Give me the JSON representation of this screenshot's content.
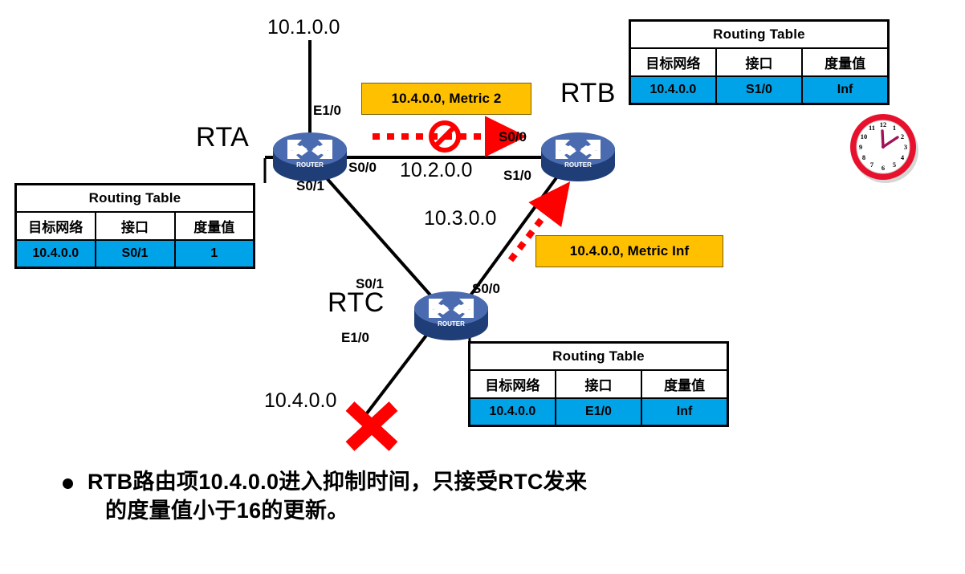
{
  "diagram": {
    "title_text": "RIP Route Poisoning / Holddown diagram",
    "colors": {
      "table_header_bg": "#FFFFFF",
      "table_data_bg": "#00A2E8",
      "update_box_bg": "#FFC000",
      "router_body": "#4A6BAF",
      "router_base": "#1F3E77",
      "blocked_arrow": "#FF0000",
      "failure_x": "#FF0000",
      "clock_rim": "#E8112D",
      "clock_hands": "#A0125A"
    },
    "routers": [
      {
        "id": "rta",
        "label": "RTA",
        "badge": "ROUTER"
      },
      {
        "id": "rtb",
        "label": "RTB",
        "badge": "ROUTER"
      },
      {
        "id": "rtc",
        "label": "RTC",
        "badge": "ROUTER"
      }
    ],
    "interfaces": [
      {
        "router": "RTA",
        "name": "E1/0"
      },
      {
        "router": "RTA",
        "name": "S0/0"
      },
      {
        "router": "RTA",
        "name": "S0/1"
      },
      {
        "router": "RTB",
        "name": "S0/0"
      },
      {
        "router": "RTB",
        "name": "S1/0"
      },
      {
        "router": "RTC",
        "name": "S0/1"
      },
      {
        "router": "RTC",
        "name": "S0/0"
      },
      {
        "router": "RTC",
        "name": "E1/0"
      }
    ],
    "networks": [
      {
        "name": "10.1.0.0",
        "attached": "RTA E1/0"
      },
      {
        "name": "10.2.0.0",
        "attached": "RTA S0/0 - RTB S0/0"
      },
      {
        "name": "10.3.0.0",
        "attached": "RTC S0/0 - RTB S1/0"
      },
      {
        "name": "10.4.0.0",
        "attached": "RTC E1/0",
        "status": "down"
      }
    ],
    "update_messages": [
      {
        "id": "blocked-update",
        "text": "10.4.0.0, Metric 2",
        "blocked": true
      },
      {
        "id": "poison-update",
        "text": "10.4.0.0, Metric Inf",
        "blocked": false
      }
    ],
    "routing_tables": [
      {
        "id": "rta-table",
        "title": "Routing Table",
        "headers": [
          "目标网络",
          "接口",
          "度量值"
        ],
        "rows": [
          [
            "10.4.0.0",
            "S0/1",
            "1"
          ]
        ]
      },
      {
        "id": "rtb-table",
        "title": "Routing Table",
        "headers": [
          "目标网络",
          "接口",
          "度量值"
        ],
        "rows": [
          [
            "10.4.0.0",
            "S1/0",
            "Inf"
          ]
        ]
      },
      {
        "id": "rtc-table",
        "title": "Routing Table",
        "headers": [
          "目标网络",
          "接口",
          "度量值"
        ],
        "rows": [
          [
            "10.4.0.0",
            "E1/0",
            "Inf"
          ]
        ]
      }
    ],
    "clock": {
      "name": "holddown-timer-clock",
      "hour_marks": [
        "12",
        "1",
        "2",
        "3",
        "4",
        "5",
        "6",
        "7",
        "8",
        "9",
        "10",
        "11"
      ]
    },
    "bullet": {
      "marker": "•",
      "line1": "RTB路由项10.4.0.0进入抑制时间，只接受RTC发来",
      "line2": "的度量值小于16的更新。"
    }
  }
}
